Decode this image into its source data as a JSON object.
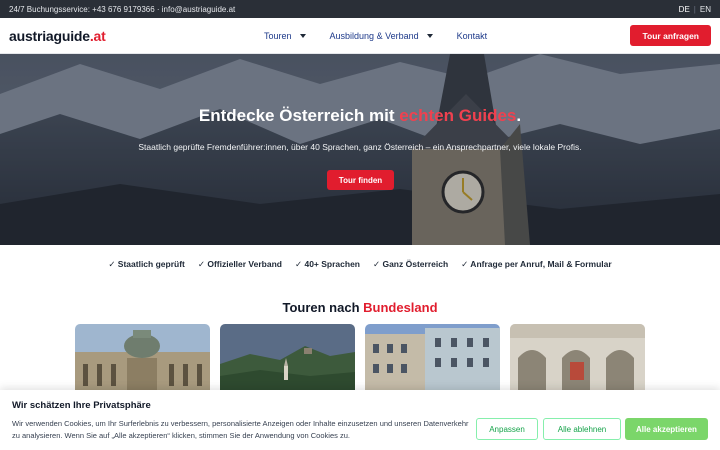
{
  "topbar": {
    "contact": "24/7 Buchungsservice: +43 676 9179366 · info@austriaguide.at",
    "lang_de": "DE",
    "lang_sep": "|",
    "lang_en": "EN"
  },
  "nav": {
    "logo_main": "austriaguide",
    "logo_tld": ".at",
    "items": [
      {
        "label": "Touren",
        "has_dropdown": true
      },
      {
        "label": "Ausbildung & Verband",
        "has_dropdown": true
      },
      {
        "label": "Kontakt",
        "has_dropdown": false
      }
    ],
    "cta": "Tour anfragen"
  },
  "hero": {
    "title_main": "Entdecke Österreich mit ",
    "title_accent": "echten Guides",
    "title_end": ".",
    "subtitle": "Staatlich geprüfte Fremdenführer:innen, über 40 Sprachen, ganz Österreich – ein Ansprechpartner, viele lokale Profis.",
    "button": "Tour finden"
  },
  "features": [
    "✓ Staatlich geprüft",
    "✓ Offizieller Verband",
    "✓ 40+ Sprachen",
    "✓ Ganz Österreich",
    "✓ Anfrage per Anruf, Mail & Formular"
  ],
  "section": {
    "title_main": "Touren nach ",
    "title_accent": "Bundesland"
  },
  "cards": [
    {
      "name": "card-vienna-palace"
    },
    {
      "name": "card-wachau-landscape"
    },
    {
      "name": "card-salzburg-building"
    },
    {
      "name": "card-courtyard-arcade"
    }
  ],
  "cookie": {
    "title": "Wir schätzen Ihre Privatsphäre",
    "text": "Wir verwenden Cookies, um Ihr Surferlebnis zu verbessern, personalisierte Anzeigen oder Inhalte einzusetzen und unseren Datenverkehr zu analysieren. Wenn Sie auf „Alle akzeptieren“ klicken, stimmen Sie der Anwendung von Cookies zu.",
    "customize": "Anpassen",
    "reject": "Alle ablehnen",
    "accept": "Alle akzeptieren"
  },
  "colors": {
    "accent_red": "#e11d2e",
    "accept_green": "#7bd66a",
    "topbar_bg": "#2a2f37"
  }
}
